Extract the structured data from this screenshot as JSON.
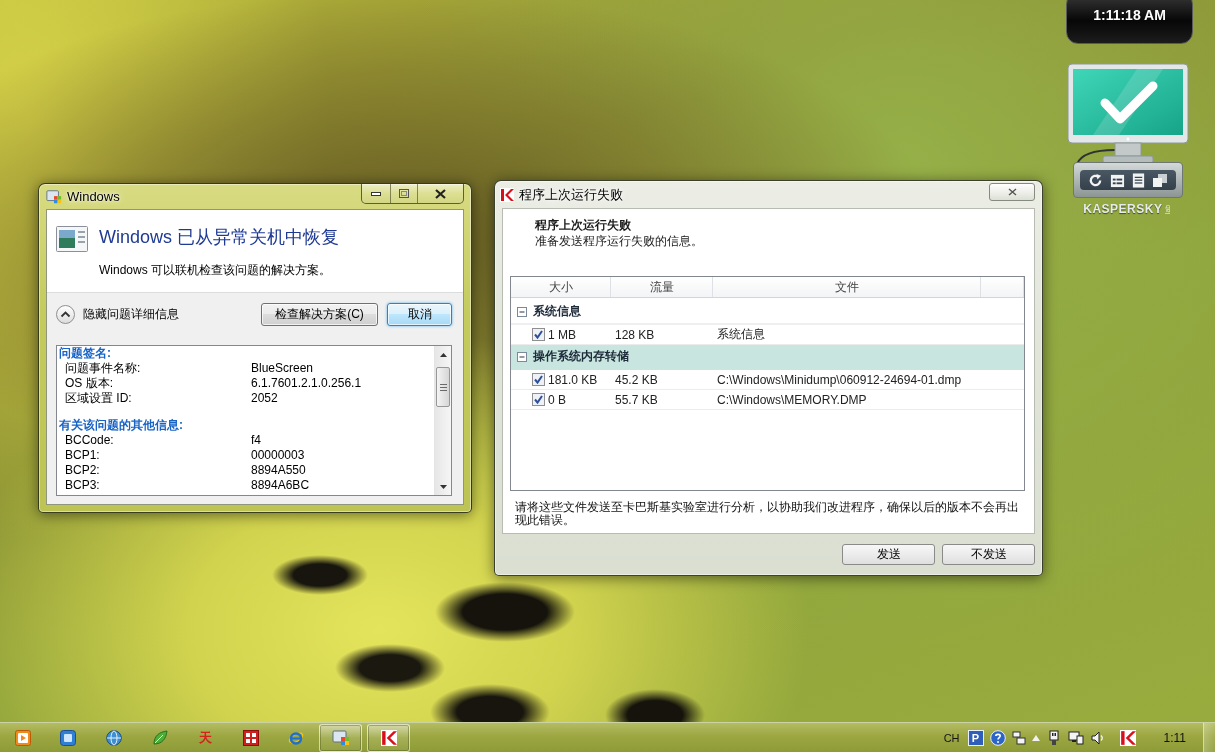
{
  "desktop": {
    "clock_gadget": {
      "time": "1:11:18 AM"
    },
    "security_gadget": {
      "logo": "KASPERSKY",
      "logo_suffix": "lab"
    }
  },
  "windows_dialog": {
    "title": "Windows",
    "heading": "Windows 已从异常关机中恢复",
    "message": "Windows 可以联机检查该问题的解决方案。",
    "details_toggle": {
      "label": "隐藏问题详细信息",
      "expanded": true
    },
    "buttons": [
      {
        "label": "检查解决方案(C)",
        "default": false
      },
      {
        "label": "取消",
        "default": true
      }
    ],
    "details": [
      {
        "kind": "heading",
        "text": "问题签名:"
      },
      {
        "kind": "row",
        "label": "问题事件名称:",
        "value": "BlueScreen"
      },
      {
        "kind": "row",
        "label": "OS 版本:",
        "value": "6.1.7601.2.1.0.256.1"
      },
      {
        "kind": "row",
        "label": "区域设置 ID:",
        "value": "2052"
      },
      {
        "kind": "heading",
        "text": "有关该问题的其他信息:"
      },
      {
        "kind": "row",
        "label": "BCCode:",
        "value": "f4"
      },
      {
        "kind": "row",
        "label": "BCP1:",
        "value": "00000003"
      },
      {
        "kind": "row",
        "label": "BCP2:",
        "value": "8894A550"
      },
      {
        "kind": "row",
        "label": "BCP3:",
        "value": "8894A6BC"
      }
    ]
  },
  "report_dialog": {
    "title": "程序上次运行失败",
    "heading": "程序上次运行失败",
    "subtitle": "准备发送程序运行失败的信息。",
    "table": {
      "columns": [
        "大小",
        "流量",
        "文件"
      ],
      "groups": [
        {
          "name": "系统信息",
          "expanded": true,
          "selected": false,
          "rows": [
            {
              "checked": true,
              "size": "1 MB",
              "traffic": "128 KB",
              "file": "系统信息"
            }
          ]
        },
        {
          "name": "操作系统内存转储",
          "expanded": true,
          "selected": true,
          "rows": [
            {
              "checked": true,
              "size": "181.0 KB",
              "traffic": "45.2 KB",
              "file": "C:\\Windows\\Minidump\\060912-24694-01.dmp"
            },
            {
              "checked": true,
              "size": "0 B",
              "traffic": "55.7 KB",
              "file": "C:\\Windows\\MEMORY.DMP"
            }
          ]
        }
      ]
    },
    "note": "请将这些文件发送至卡巴斯基实验室进行分析，以协助我们改进程序，确保以后的版本不会再出现此错误。",
    "buttons": [
      "发送",
      "不发送"
    ]
  },
  "taskbar": {
    "pinned": [
      {
        "kind": "media"
      },
      {
        "kind": "app"
      },
      {
        "kind": "globe"
      },
      {
        "kind": "leaf"
      },
      {
        "kind": "glyph",
        "text": "天"
      },
      {
        "kind": "seal"
      },
      {
        "kind": "browser"
      }
    ],
    "windows": [
      {
        "kind": "system"
      },
      {
        "kind": "antivirus"
      }
    ],
    "language": "CH",
    "tray": [
      {
        "kind": "letter",
        "text": "P"
      },
      {
        "kind": "help"
      },
      {
        "kind": "notify"
      },
      {
        "kind": "expand"
      },
      {
        "kind": "device"
      },
      {
        "kind": "network"
      },
      {
        "kind": "volume"
      },
      {
        "kind": "antivirus"
      }
    ],
    "clock": "1:11"
  }
}
